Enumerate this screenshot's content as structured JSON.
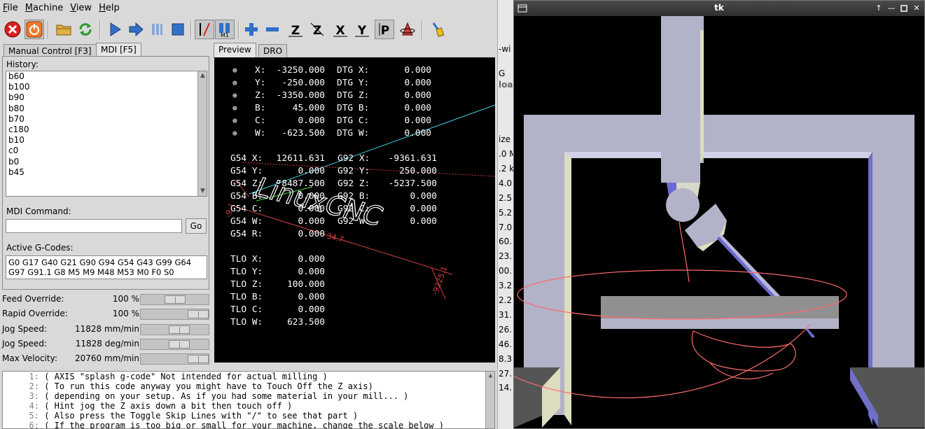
{
  "menubar": {
    "items": [
      {
        "first": "F",
        "rest": "ile"
      },
      {
        "first": "M",
        "rest": "achine"
      },
      {
        "first": "V",
        "rest": "iew"
      },
      {
        "first": "H",
        "rest": "elp"
      }
    ]
  },
  "toolbar": {
    "estop_icon": "estop-icon",
    "power_icon": "power-icon"
  },
  "left_tabs": {
    "manual": "Manual Control [F3]",
    "mdi": "MDI [F5]"
  },
  "mdi": {
    "history_label": "History:",
    "history": [
      "b60",
      "b100",
      "b90",
      "b80",
      "b70",
      "c180",
      "b10",
      "c0",
      "b0",
      "b45"
    ],
    "command_label": "MDI Command:",
    "command_value": "",
    "go_label": "Go",
    "active_label": "Active G-Codes:",
    "active_line1": "G0 G17 G40 G21 G90 G94 G54 G43 G99 G64",
    "active_line2": "G97 G91.1 G8 M5 M9 M48 M53 M0 F0 S0"
  },
  "overrides": [
    {
      "name": "Feed Override:",
      "value": "100 %",
      "level": 0.5
    },
    {
      "name": "Rapid Override:",
      "value": "100 %",
      "level": 1.0
    },
    {
      "name": "Jog Speed:",
      "value": "11828 mm/min",
      "level": 0.6
    },
    {
      "name": "Jog Speed:",
      "value": "11828 deg/min",
      "level": 0.6
    },
    {
      "name": "Max Velocity:",
      "value": "20760 mm/min",
      "level": 1.0
    }
  ],
  "view_tabs": {
    "preview": "Preview",
    "dro": "DRO"
  },
  "dro": {
    "pos": [
      {
        "axis": "X:",
        "value": "-3250.000",
        "dtg_label": "DTG X:",
        "dtg": "0.000"
      },
      {
        "axis": "Y:",
        "value": "-250.000",
        "dtg_label": "DTG Y:",
        "dtg": "0.000"
      },
      {
        "axis": "Z:",
        "value": "-3350.000",
        "dtg_label": "DTG Z:",
        "dtg": "0.000"
      },
      {
        "axis": "B:",
        "value": "45.000",
        "dtg_label": "DTG B:",
        "dtg": "0.000"
      },
      {
        "axis": "C:",
        "value": "0.000",
        "dtg_label": "DTG C:",
        "dtg": "0.000"
      },
      {
        "axis": "W:",
        "value": "-623.500",
        "dtg_label": "DTG W:",
        "dtg": "0.000"
      }
    ],
    "offsets": [
      {
        "g54": "G54 X:",
        "g54v": "12611.631",
        "g92": "G92 X:",
        "g92v": "-9361.631"
      },
      {
        "g54": "G54 Y:",
        "g54v": "0.000",
        "g92": "G92 Y:",
        "g92v": "250.000"
      },
      {
        "g54": "G54 Z:",
        "g54v": "8487.500",
        "g92": "G92 Z:",
        "g92v": "-5237.500"
      },
      {
        "g54": "G54 B:",
        "g54v": "0.000",
        "g92": "G92 B:",
        "g92v": "0.000"
      },
      {
        "g54": "G54 C:",
        "g54v": "0.000",
        "g92": "G92 C:",
        "g92v": "0.000"
      },
      {
        "g54": "G54 W:",
        "g54v": "0.000",
        "g92": "G92 W:",
        "g92v": "0.000"
      },
      {
        "g54": "G54 R:",
        "g54v": "0.000",
        "g92": "",
        "g92v": ""
      }
    ],
    "tlo": [
      {
        "label": "TLO X:",
        "value": "0.000"
      },
      {
        "label": "TLO Y:",
        "value": "0.000"
      },
      {
        "label": "TLO Z:",
        "value": "100.000"
      },
      {
        "label": "TLO B:",
        "value": "0.000"
      },
      {
        "label": "TLO C:",
        "value": "0.000"
      },
      {
        "label": "TLO W:",
        "value": "623.500"
      }
    ],
    "dim_label_1": "-9225.1",
    "dim_label_2": "34.7",
    "dim_label_3": "-9",
    "splash_text": "LinuxCNC"
  },
  "program": [
    {
      "n": "1:",
      "text": "( AXIS \"splash g-code\" Not intended for actual milling )"
    },
    {
      "n": "2:",
      "text": "( To run this code anyway you might have to Touch Off the Z axis)"
    },
    {
      "n": "3:",
      "text": "( depending on your setup. As if you had some material in your mill... )"
    },
    {
      "n": "4:",
      "text": "( Hint jog the Z axis down a bit then touch off )"
    },
    {
      "n": "5:",
      "text": "( Also press the Toggle Skip Lines with \"/\" to see that part )"
    },
    {
      "n": "6:",
      "text": "( If the program is too big or small for your machine, change the scale below )"
    }
  ],
  "background_window": {
    "frag1": "-wi",
    "frag2": "G",
    "frag3": "loa",
    "col_header": "ize",
    "sizes": [
      ".0 M",
      ".2 k",
      "4.0",
      "2.5",
      "5.2",
      "7.0",
      "60.",
      "23.",
      "00.",
      "3.2",
      "2.2",
      "31.",
      "26.",
      "46.",
      "8.3",
      "27.",
      "14."
    ]
  },
  "tk_window": {
    "title": "tk"
  }
}
